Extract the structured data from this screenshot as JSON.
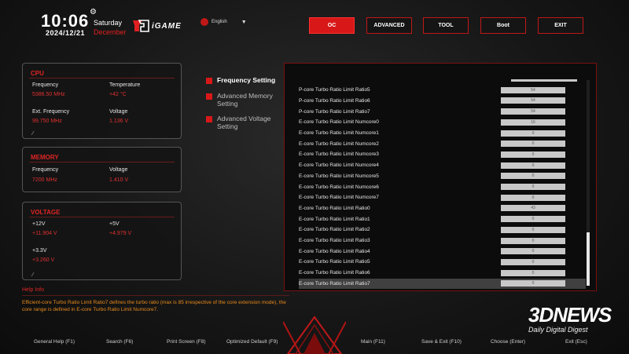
{
  "header": {
    "time": "10:06",
    "date": "2024/12/21",
    "weekday": "Saturday",
    "month": "December",
    "brand": "iGAME",
    "language": "English"
  },
  "nav": [
    {
      "label": "OC",
      "active": true
    },
    {
      "label": "ADVANCED",
      "active": false
    },
    {
      "label": "TOOL",
      "active": false
    },
    {
      "label": "Boot",
      "active": false
    },
    {
      "label": "EXIT",
      "active": false
    }
  ],
  "cpu": {
    "title": "CPU",
    "frequency_label": "Frequency",
    "frequency": "5386.50 MHz",
    "temperature_label": "Temperature",
    "temperature": "+42 °C",
    "ext_frequency_label": "Ext. Frequency",
    "ext_frequency": "99.750 MHz",
    "voltage_label": "Voltage",
    "voltage": "1.136 V"
  },
  "memory": {
    "title": "MEMORY",
    "frequency_label": "Frequency",
    "frequency": "7200 MHz",
    "voltage_label": "Voltage",
    "voltage": "1.410 V"
  },
  "voltage": {
    "title": "VOLTAGE",
    "v12_label": "+12V",
    "v12": "+11.904 V",
    "v5_label": "+5V",
    "v5": "+4.979 V",
    "v33_label": "+3.3V",
    "v33": "+3.260 V"
  },
  "submenu": [
    {
      "label": "Frequency Setting",
      "active": true
    },
    {
      "label": "Advanced Memory Setting",
      "active": false
    },
    {
      "label": "Advanced Voltage Setting",
      "active": false
    }
  ],
  "settings": [
    {
      "label": "P-core Turbo Ratio Limit Ratio5",
      "value": "54"
    },
    {
      "label": "P-core Turbo Ratio Limit Ratio6",
      "value": "54"
    },
    {
      "label": "P-core Turbo Ratio Limit Ratio7",
      "value": "54"
    },
    {
      "label": "E-core Turbo Ratio Limit Numcore0",
      "value": "16"
    },
    {
      "label": "E-core Turbo Ratio Limit Numcore1",
      "value": "0"
    },
    {
      "label": "E-core Turbo Ratio Limit Numcore2",
      "value": "0"
    },
    {
      "label": "E-core Turbo Ratio Limit Numcore3",
      "value": "0"
    },
    {
      "label": "E-core Turbo Ratio Limit Numcore4",
      "value": "0"
    },
    {
      "label": "E-core Turbo Ratio Limit Numcore5",
      "value": "0"
    },
    {
      "label": "E-core Turbo Ratio Limit Numcore6",
      "value": "0"
    },
    {
      "label": "E-core Turbo Ratio Limit Numcore7",
      "value": "0"
    },
    {
      "label": "E-core Turbo Ratio Limit Ratio0",
      "value": "43"
    },
    {
      "label": "E-core Turbo Ratio Limit Ratio1",
      "value": "0"
    },
    {
      "label": "E-core Turbo Ratio Limit Ratio2",
      "value": "0"
    },
    {
      "label": "E-core Turbo Ratio Limit Ratio3",
      "value": "0"
    },
    {
      "label": "E-core Turbo Ratio Limit Ratio4",
      "value": "0"
    },
    {
      "label": "E-core Turbo Ratio Limit Ratio5",
      "value": "0"
    },
    {
      "label": "E-core Turbo Ratio Limit Ratio6",
      "value": "0"
    },
    {
      "label": "E-core Turbo Ratio Limit Ratio7",
      "value": "0",
      "selected": true
    }
  ],
  "help": {
    "title": "Help Info",
    "text": "Efficient-core Turbo Ratio Limit Ratio7 defines the turbo ratio (max is 85 irrespective of the core extension mode), the core range is defined in E-core Turbo Ratio Limit Numcore7."
  },
  "footer": [
    "General Help (F1)",
    "Search (F6)",
    "Print Screen (F8)",
    "Optimized Default (F9)",
    "Main (F11)",
    "Save & Exit (F10)",
    "Choose (Enter)",
    "Exit (Esc)"
  ],
  "watermark": {
    "big": "3DNEWS",
    "small": "Daily Digital Digest"
  },
  "colors": {
    "accent": "#d81818",
    "help_text": "#e88a1c",
    "value_red": "#e03030"
  }
}
